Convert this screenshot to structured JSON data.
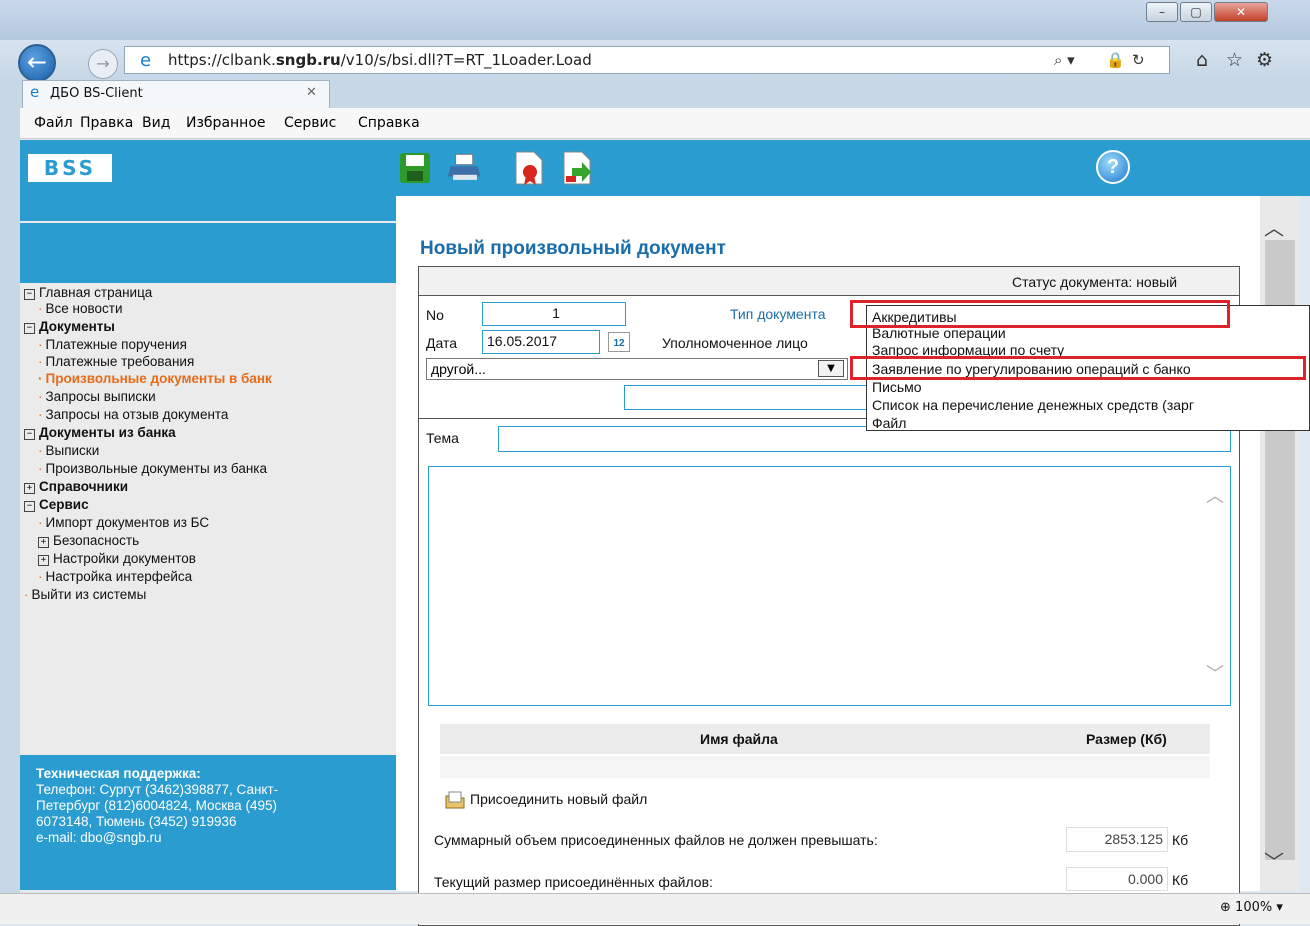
{
  "browser": {
    "url_prefix": "https://clbank.",
    "url_domain": "sngb.ru",
    "url_path": "/v10/s/bsi.dll?T=RT_1Loader.Load",
    "tab_title": "ДБО BS-Client",
    "zoom": "100%",
    "menu": [
      "Файл",
      "Правка",
      "Вид",
      "Избранное",
      "Сервис",
      "Справка"
    ]
  },
  "app": {
    "logo": "BSS",
    "help": "?"
  },
  "sidebar": {
    "main_page": "Главная страница",
    "all_news": "Все новости",
    "documents": "Документы",
    "payment_orders": "Платежные поручения",
    "payment_requests": "Платежные требования",
    "arbitrary_docs_to_bank": "Произвольные документы в банк",
    "statement_requests": "Запросы выписки",
    "recall_requests": "Запросы на отзыв документа",
    "docs_from_bank": "Документы из банка",
    "statements": "Выписки",
    "arbitrary_docs_from_bank": "Произвольные документы из банка",
    "references": "Справочники",
    "service": "Сервис",
    "import_docs": "Импорт документов из БС",
    "security": "Безопасность",
    "doc_settings": "Настройки документов",
    "ui_settings": "Настройка интерфейса",
    "logout": "Выйти из системы"
  },
  "support": {
    "title": "Техническая поддержка:",
    "line1": "Телефон: Сургут (3462)398877, Санкт-",
    "line2": "Петербург (812)6004824, Москва (495)",
    "line3": "6073148, Тюмень (3452) 919936",
    "line4": "e-mail: dbo@sngb.ru"
  },
  "document": {
    "title": "Новый произвольный документ",
    "status": "Статус документа: новый",
    "no_label": "No",
    "no_value": "1",
    "date_label": "Дата",
    "date_value": "16.05.2017",
    "calendar": "12",
    "doc_type_label": "Тип документа",
    "authorized_label": "Уполномоченное лицо",
    "recipient_value": "другой...",
    "subject_label": "Тема",
    "file_name_header": "Имя файла",
    "file_size_header": "Размер (Кб)",
    "attach_label": "Присоединить новый файл",
    "max_size_label": "Суммарный объем присоединенных файлов не должен превышать:",
    "max_size_value": "2853.125",
    "current_size_label": "Текущий размер присоединённых файлов:",
    "current_size_value": "0.000",
    "unit": "Кб"
  },
  "dropdown_options": [
    "Аккредитивы",
    "Валютные операции",
    "Запрос информации по счету",
    "Заявление по урегулированию операций с банко",
    "Письмо",
    "Список на перечисление денежных средств (зарг",
    "Файл"
  ]
}
